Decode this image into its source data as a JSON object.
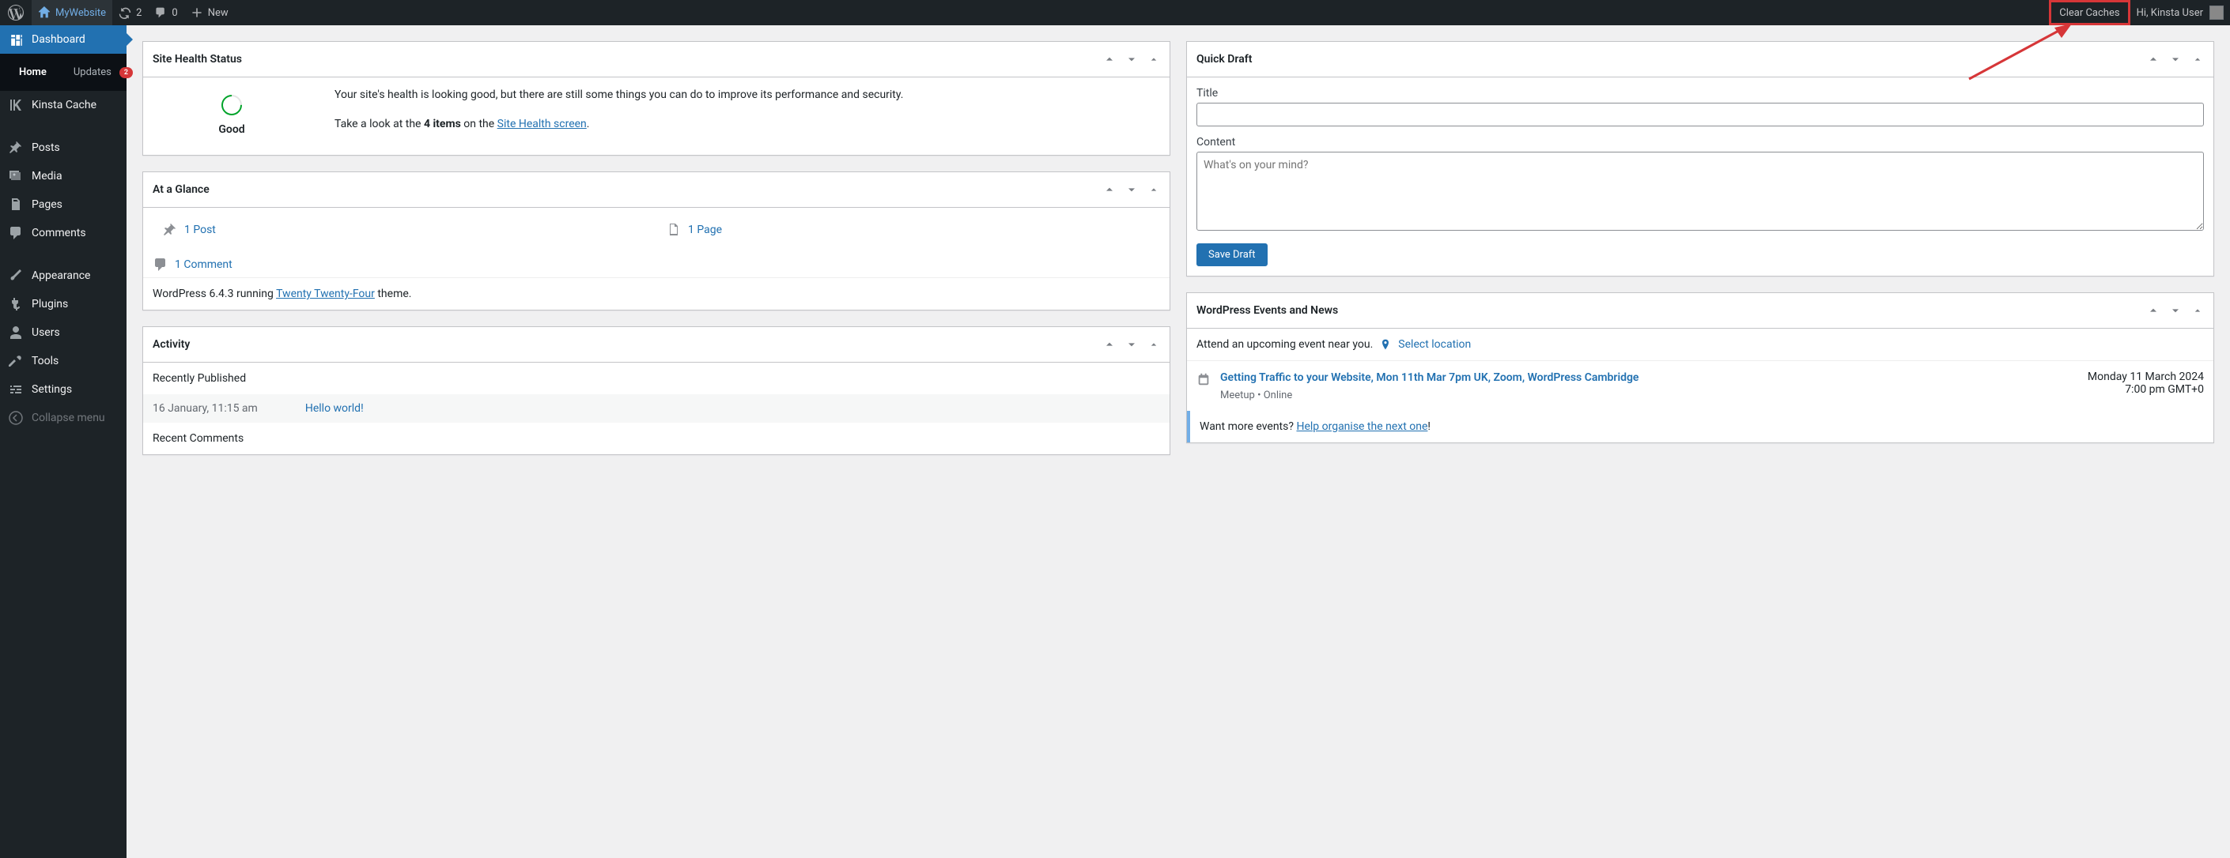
{
  "adminbar": {
    "siteName": "MyWebsite",
    "updatesCount": "2",
    "commentsCount": "0",
    "newLabel": "New",
    "clearCaches": "Clear Caches",
    "greeting": "Hi, Kinsta User"
  },
  "sidebar": {
    "dashboard": "Dashboard",
    "home": "Home",
    "updates": "Updates",
    "updatesBadge": "2",
    "kinstaCache": "Kinsta Cache",
    "posts": "Posts",
    "media": "Media",
    "pages": "Pages",
    "comments": "Comments",
    "appearance": "Appearance",
    "plugins": "Plugins",
    "users": "Users",
    "tools": "Tools",
    "settings": "Settings",
    "collapse": "Collapse menu"
  },
  "siteHealth": {
    "title": "Site Health Status",
    "status": "Good",
    "desc": "Your site's health is looking good, but there are still some things you can do to improve its performance and security.",
    "lookPrefix": "Take a look at the ",
    "items": "4 items",
    "onThe": " on the ",
    "screenLink": "Site Health screen",
    "period": "."
  },
  "glance": {
    "title": "At a Glance",
    "posts": "1 Post",
    "pages": "1 Page",
    "comments": "1 Comment",
    "versionPrefix": "WordPress 6.4.3 running ",
    "themeLink": "Twenty Twenty-Four",
    "themeSuffix": " theme."
  },
  "activity": {
    "title": "Activity",
    "recentlyPublished": "Recently Published",
    "pubDate": "16 January, 11:15 am",
    "pubTitle": "Hello world!",
    "recentComments": "Recent Comments"
  },
  "quickDraft": {
    "title": "Quick Draft",
    "titleLabel": "Title",
    "contentLabel": "Content",
    "contentPlaceholder": "What's on your mind?",
    "saveButton": "Save Draft"
  },
  "events": {
    "title": "WordPress Events and News",
    "intro": "Attend an upcoming event near you.",
    "selectLocation": "Select location",
    "event1Title": "Getting Traffic to your Website, Mon 11th Mar 7pm UK, Zoom, WordPress Cambridge",
    "event1Meta": "Meetup • Online",
    "event1Date": "Monday 11 March 2024",
    "event1Time": "7:00 pm GMT+0",
    "wantMore": "Want more events? ",
    "organiseLink": "Help organise the next one",
    "exclaim": "!"
  }
}
